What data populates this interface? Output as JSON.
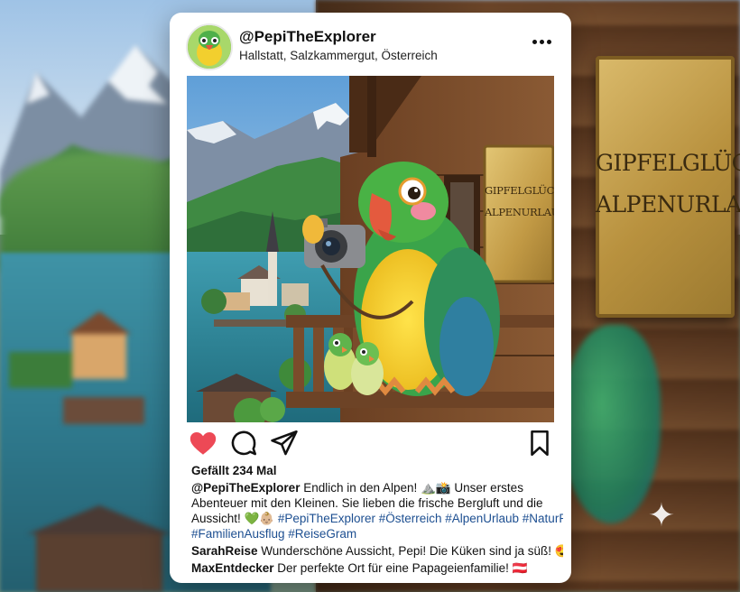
{
  "background": {
    "plaque_line1": "GIPFELGLÜCK",
    "plaque_line2": "ALPENURLAUB",
    "sparkle_icon": "sparkle-icon"
  },
  "post": {
    "username": "@PepiTheExplorer",
    "location": "Hallstatt, Salzkammergut, Österreich",
    "photo": {
      "sign_line1": "GIPFELGLÜCK",
      "sign_line2": "ALPENURLAUB"
    },
    "actions": {
      "like_icon": "heart-icon",
      "comment_icon": "comment-icon",
      "share_icon": "send-icon",
      "save_icon": "bookmark-icon",
      "liked": true,
      "like_color": "#ed4956"
    },
    "likes": "Gefällt 234 Mal",
    "caption": {
      "author": "@PepiTheExplorer",
      "line1_text": " Endlich in den Alpen! ⛰️📸 Unser erstes",
      "line2_text": "Abenteuer mit den Kleinen. Sie lieben die frische Bergluft und die",
      "line3_text": "Aussicht! 💚👶🏼 ",
      "line3_tags": "#PepiTheExplorer #Österreich #AlpenUrlaub #NaturP",
      "line4_tags": "#FamilienAusflug #ReiseGram"
    },
    "comments": [
      {
        "author": "SarahReise",
        "text": " Wunderschöne Aussicht, Pepi! Die Küken sind ja süß! 😍"
      },
      {
        "author": "MaxEntdecker",
        "text": " Der perfekte Ort für eine Papageienfamilie! 🇦🇹"
      }
    ]
  },
  "colors": {
    "tag": "#1d4f91",
    "like": "#ed4956",
    "card": "#ffffff"
  }
}
